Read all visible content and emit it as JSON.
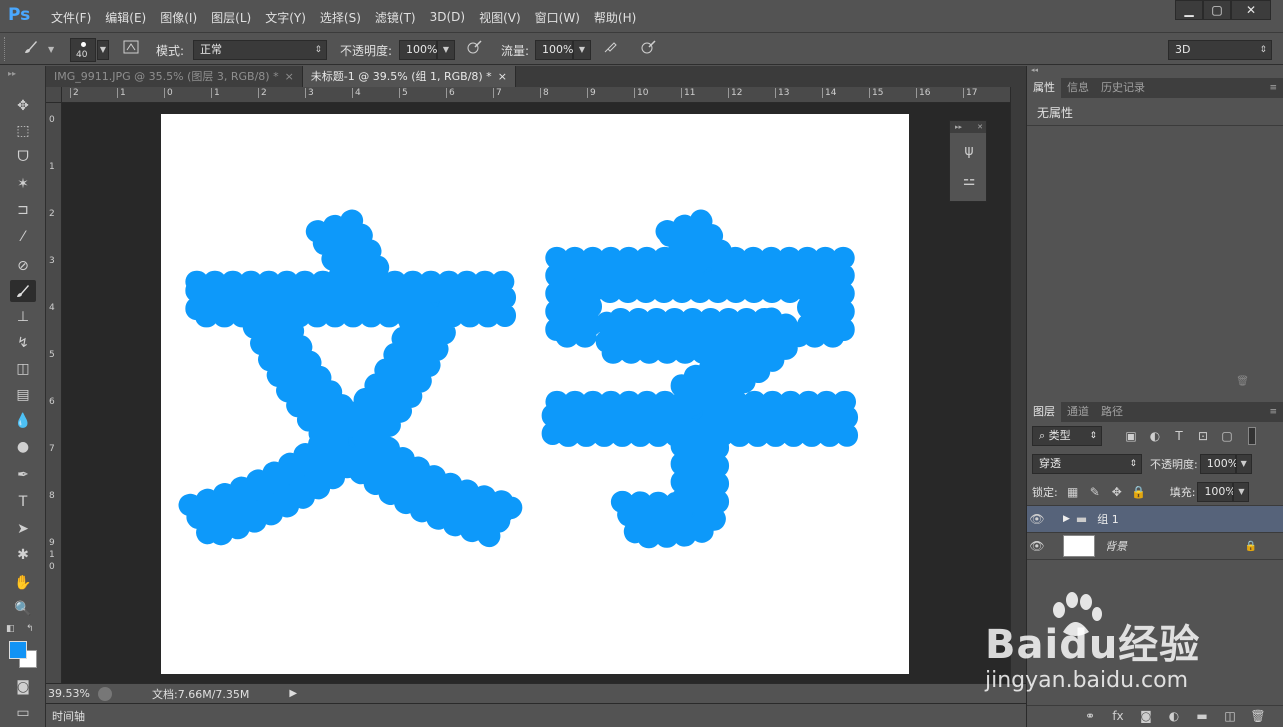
{
  "app": {
    "logo": "Ps"
  },
  "menu": [
    "文件(F)",
    "编辑(E)",
    "图像(I)",
    "图层(L)",
    "文字(Y)",
    "选择(S)",
    "滤镜(T)",
    "3D(D)",
    "视图(V)",
    "窗口(W)",
    "帮助(H)"
  ],
  "window_controls": {
    "minimize": "▁",
    "restore": "▢",
    "close": "✕"
  },
  "options": {
    "brush_size": "40",
    "mode_label": "模式:",
    "mode_value": "正常",
    "opacity_label": "不透明度:",
    "opacity_value": "100%",
    "flow_label": "流量:",
    "flow_value": "100%",
    "workspace": "3D"
  },
  "tabs": [
    {
      "label": "IMG_9911.JPG @ 35.5% (图层 3, RGB/8) *",
      "close": "×"
    },
    {
      "label": "未标题-1 @ 39.5% (组 1, RGB/8) *",
      "close": "×"
    }
  ],
  "ruler_top": [
    "2",
    "1",
    "0",
    "1",
    "2",
    "3",
    "4",
    "5",
    "6",
    "7",
    "8",
    "9",
    "10",
    "11",
    "12",
    "13",
    "14",
    "15",
    "16",
    "17"
  ],
  "ruler_left": [
    "0",
    "1",
    "2",
    "3",
    "4",
    "5",
    "6",
    "7",
    "8",
    "9",
    "1",
    "0"
  ],
  "canvas_text": "文字",
  "colors": {
    "foreground": "#1193f5",
    "background": "#ffffff",
    "text_fill": "#0d99fa",
    "accent": "#4aa8ff"
  },
  "status": {
    "zoom": "39.53%",
    "doc": "文档:7.66M/7.35M"
  },
  "timeline": "时间轴",
  "properties": {
    "tabs": [
      "属性",
      "信息",
      "历史记录"
    ],
    "content": "无属性"
  },
  "layers": {
    "tabs": [
      "图层",
      "通道",
      "路径"
    ],
    "filter_kind": "类型",
    "blend_mode": "穿透",
    "opacity_label": "不透明度:",
    "opacity_value": "100%",
    "lock_label": "锁定:",
    "fill_label": "填充:",
    "fill_value": "100%",
    "items": [
      {
        "name": "组 1"
      },
      {
        "name": "背景"
      }
    ]
  },
  "watermark": {
    "brand": "Baidu经验",
    "url": "jingyan.baidu.com"
  }
}
